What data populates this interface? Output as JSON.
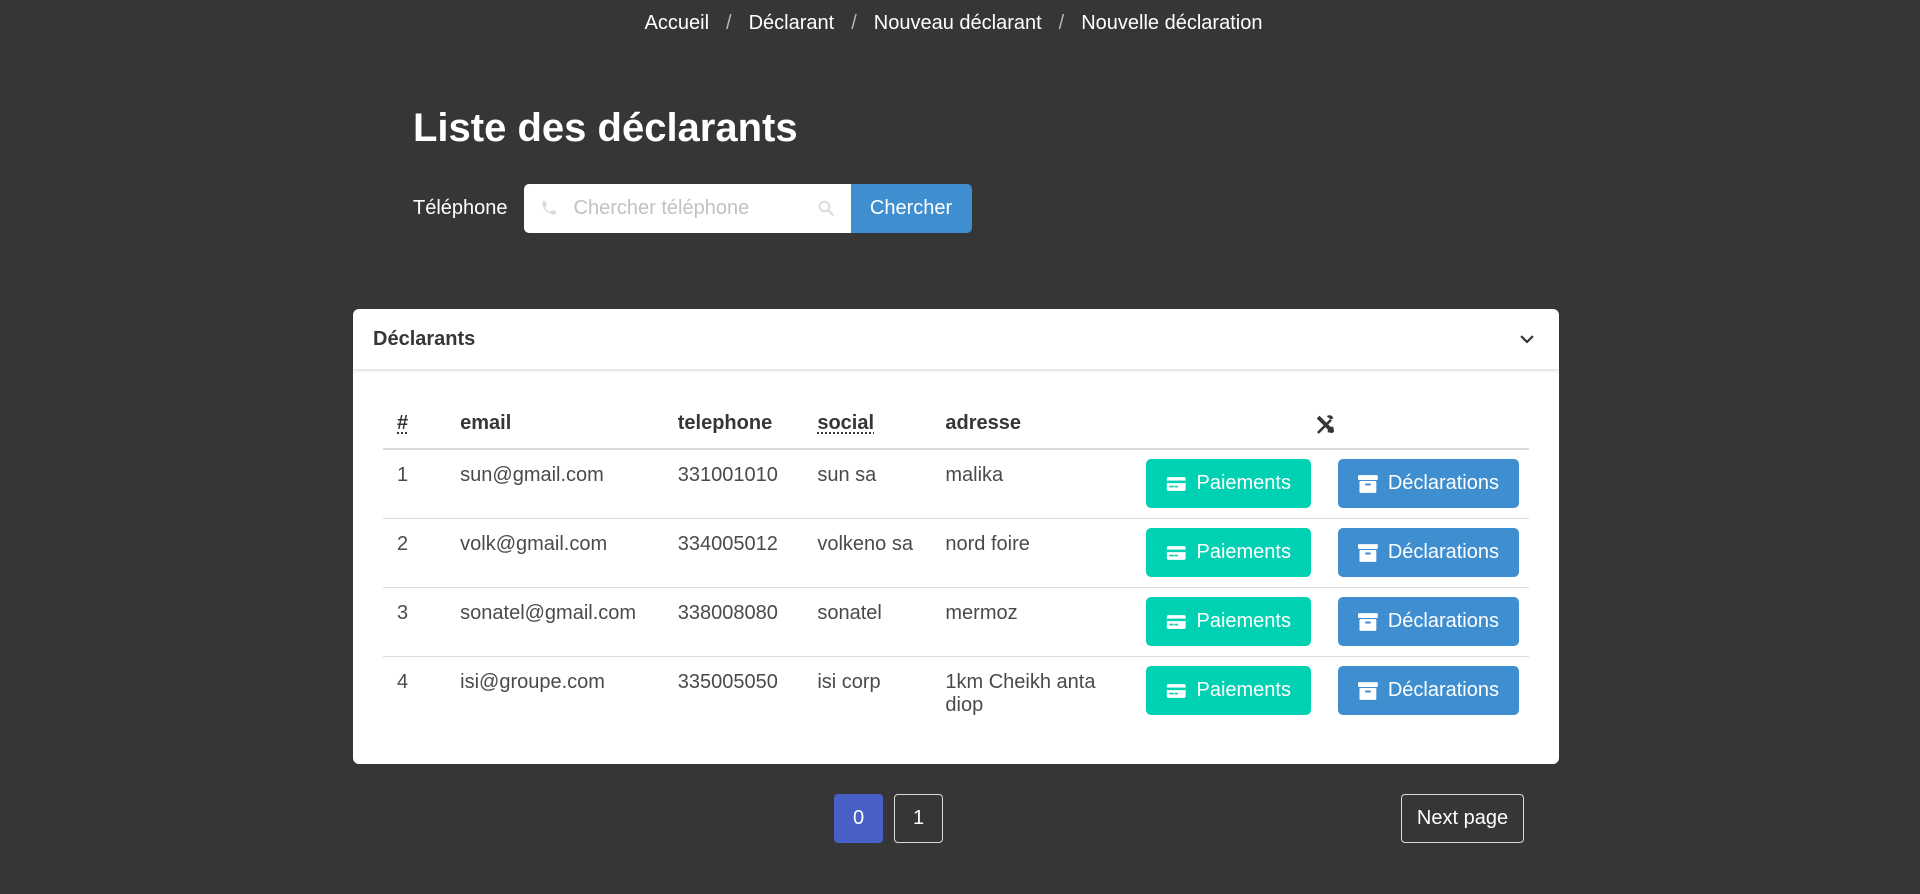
{
  "breadcrumb": [
    "Accueil",
    "Déclarant",
    "Nouveau déclarant",
    "Nouvelle déclaration"
  ],
  "breadcrumb_separator": "/",
  "page_title": "Liste des déclarants",
  "search": {
    "label": "Téléphone",
    "placeholder": "Chercher téléphone",
    "value": "",
    "button_label": "Chercher",
    "left_icon": "phone-icon",
    "right_icon": "search-icon"
  },
  "card": {
    "title": "Déclarants",
    "toggle_icon": "chevron-down-icon"
  },
  "table": {
    "headers": {
      "num": "#",
      "email": "email",
      "telephone": "telephone",
      "social": "social",
      "adresse": "adresse",
      "tools_icon": "tools-icon"
    },
    "rows": [
      {
        "num": "1",
        "email": "sun@gmail.com",
        "telephone": "331001010",
        "social": "sun sa",
        "adresse": "malika"
      },
      {
        "num": "2",
        "email": "volk@gmail.com",
        "telephone": "334005012",
        "social": "volkeno sa",
        "adresse": "nord foire"
      },
      {
        "num": "3",
        "email": "sonatel@gmail.com",
        "telephone": "338008080",
        "social": "sonatel",
        "adresse": "mermoz"
      },
      {
        "num": "4",
        "email": "isi@groupe.com",
        "telephone": "335005050",
        "social": "isi corp",
        "adresse": "1km Cheikh anta diop"
      }
    ],
    "actions": {
      "payments_label": "Paiements",
      "payments_icon": "credit-card-icon",
      "declarations_label": "Déclarations",
      "declarations_icon": "archive-icon"
    }
  },
  "pagination": {
    "pages": [
      "0",
      "1"
    ],
    "current": "0",
    "next_label": "Next page"
  },
  "colors": {
    "background": "#363636",
    "primary_blue": "#3e8ed0",
    "success_teal": "#00d1b2",
    "current_page": "#485fc7"
  }
}
